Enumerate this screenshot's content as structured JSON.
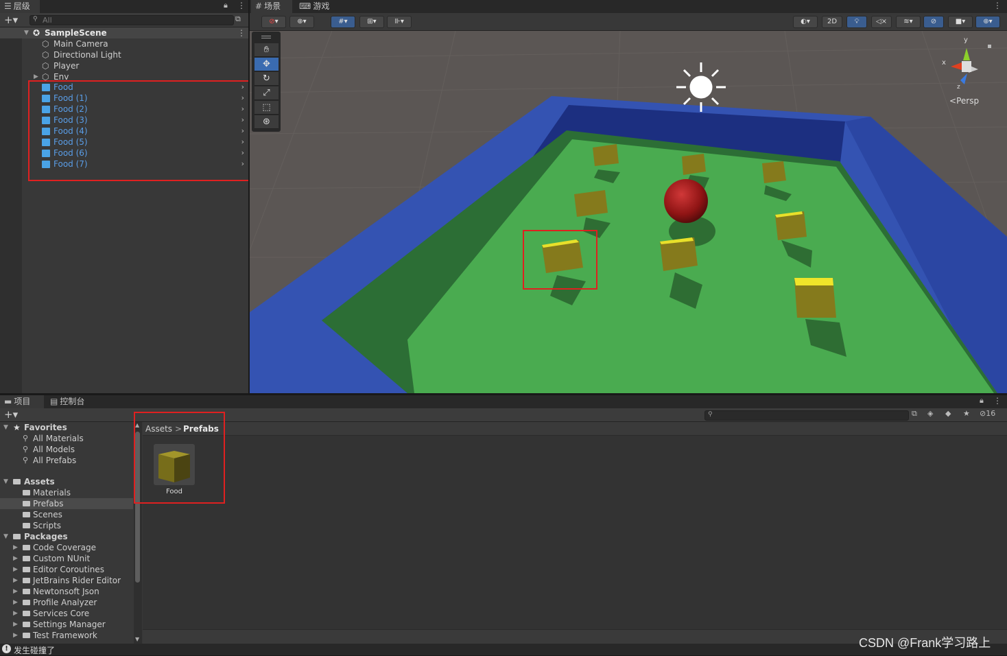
{
  "hierarchy": {
    "tab_label": "层级",
    "search_placeholder": "All",
    "scene_name": "SampleScene",
    "items": [
      {
        "label": "Main Camera"
      },
      {
        "label": "Directional Light"
      },
      {
        "label": "Player"
      },
      {
        "label": "Env"
      }
    ],
    "food_items": [
      {
        "label": "Food"
      },
      {
        "label": "Food (1)"
      },
      {
        "label": "Food (2)"
      },
      {
        "label": "Food (3)"
      },
      {
        "label": "Food (4)"
      },
      {
        "label": "Food (5)"
      },
      {
        "label": "Food (6)"
      },
      {
        "label": "Food (7)"
      }
    ]
  },
  "scene": {
    "tab_scene": "场景",
    "tab_game": "游戏",
    "btn_2d": "2D",
    "gizmo_y": "y",
    "gizmo_x": "x",
    "gizmo_z": "z",
    "persp_label": "Persp",
    "colors": {
      "ground": "#46a84b",
      "wall": "#2e49a6",
      "food": "#857a1c",
      "player": "#9a1717",
      "highlight": "#e02020"
    }
  },
  "project": {
    "tab_project": "项目",
    "tab_console": "控制台",
    "favorites_label": "Favorites",
    "favorites": [
      {
        "label": "All Materials"
      },
      {
        "label": "All Models"
      },
      {
        "label": "All Prefabs"
      }
    ],
    "assets_label": "Assets",
    "assets": [
      {
        "label": "Materials"
      },
      {
        "label": "Prefabs"
      },
      {
        "label": "Scenes"
      },
      {
        "label": "Scripts"
      }
    ],
    "packages_label": "Packages",
    "packages": [
      {
        "label": "Code Coverage"
      },
      {
        "label": "Custom NUnit"
      },
      {
        "label": "Editor Coroutines"
      },
      {
        "label": "JetBrains Rider Editor"
      },
      {
        "label": "Newtonsoft Json"
      },
      {
        "label": "Profile Analyzer"
      },
      {
        "label": "Services Core"
      },
      {
        "label": "Settings Manager"
      },
      {
        "label": "Test Framework"
      }
    ],
    "breadcrumb_root": "Assets",
    "breadcrumb_sep": ">",
    "breadcrumb_current": "Prefabs",
    "asset_name": "Food",
    "hidden_count": "16"
  },
  "status": {
    "message": "发生碰撞了"
  },
  "watermark": "CSDN @Frank学习路上"
}
